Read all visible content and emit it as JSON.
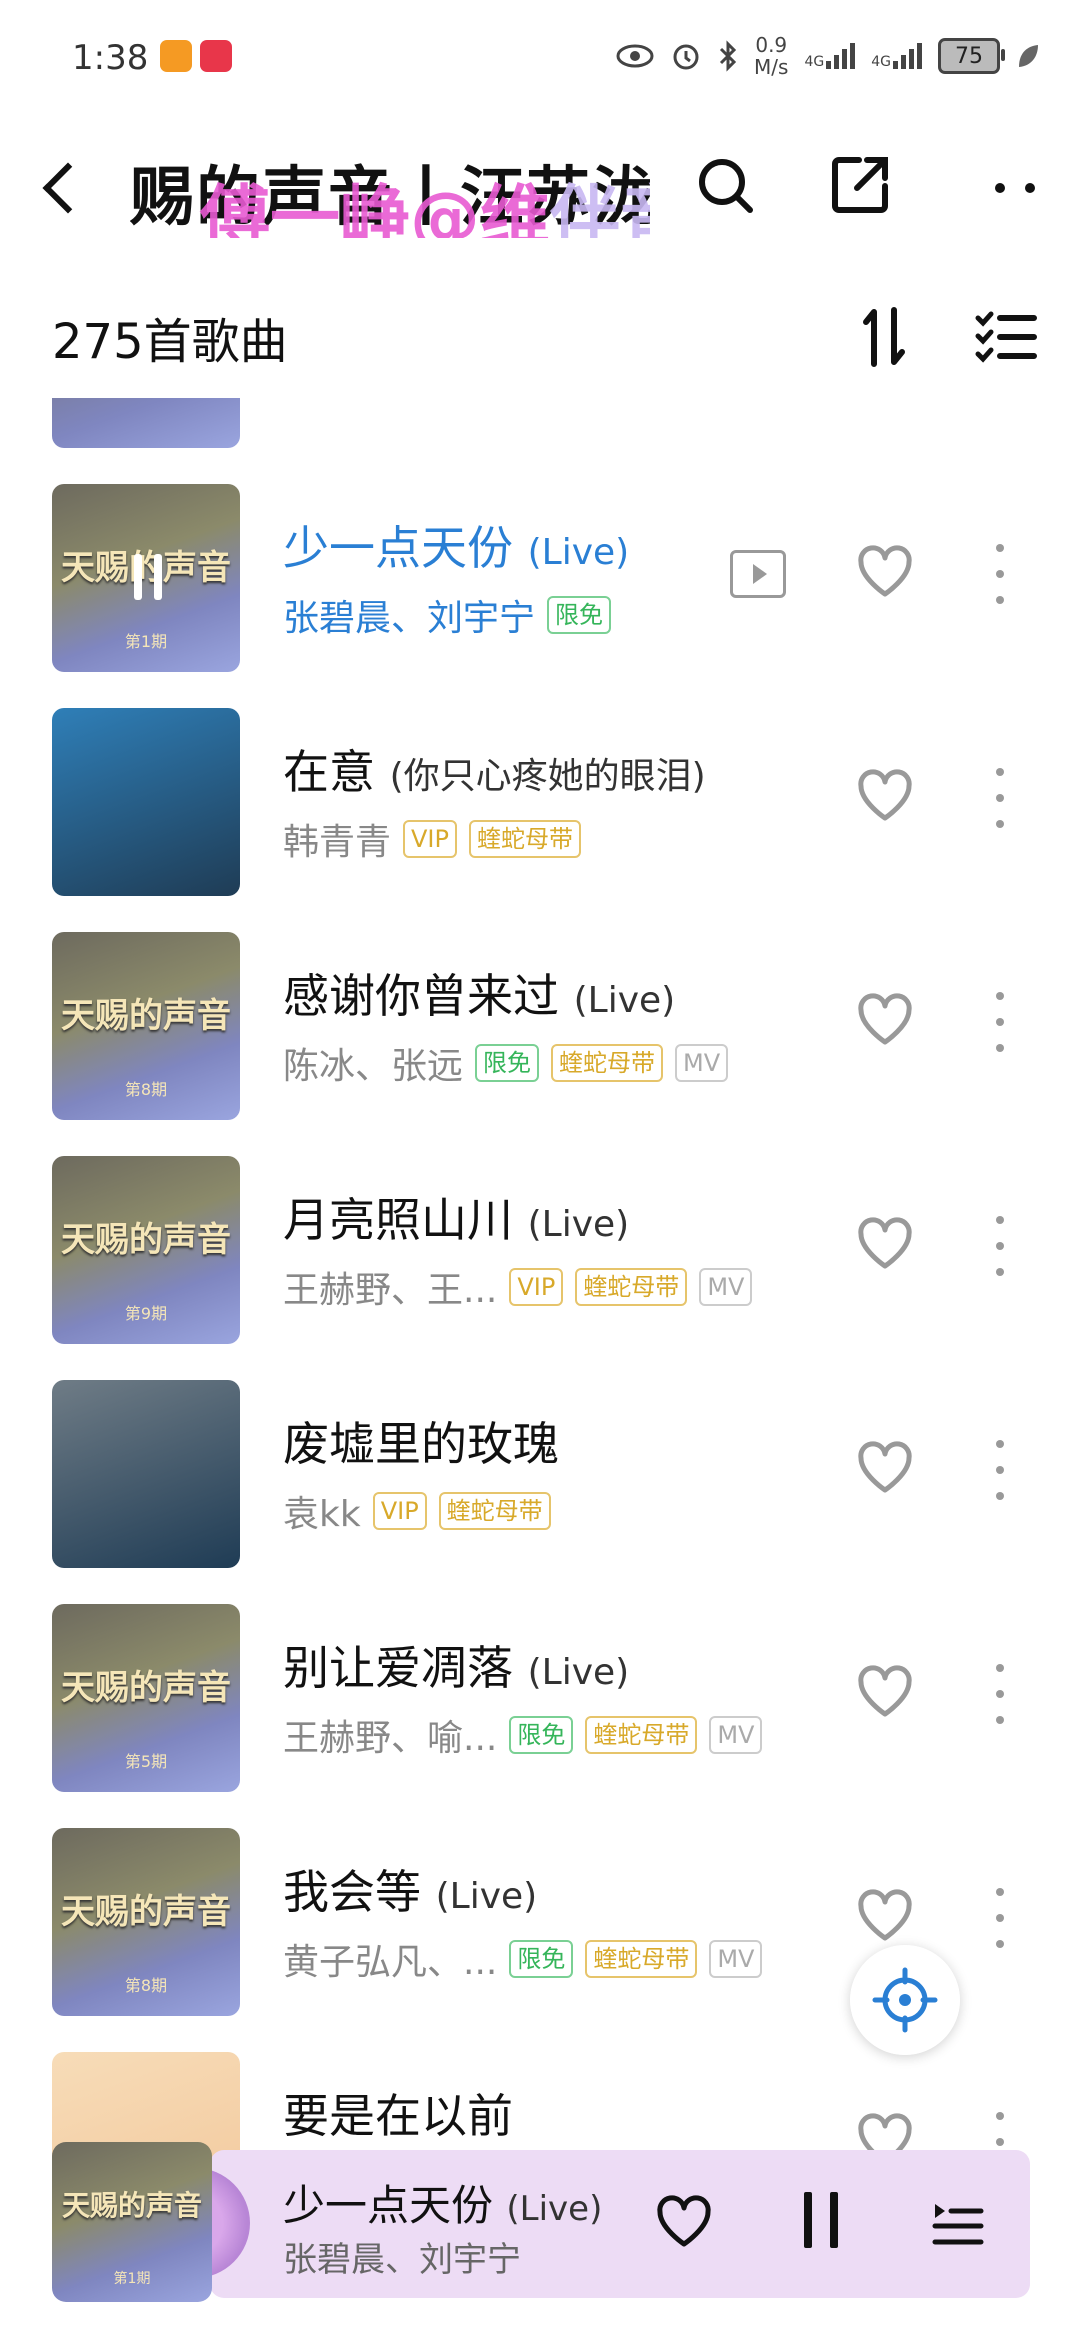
{
  "status_bar": {
    "time": "1:38",
    "net_speed_value": "0.9",
    "net_speed_unit": "M/s",
    "signal_1": "4G",
    "signal_2": "4G",
    "battery": "75"
  },
  "header": {
    "title": "赐的声音丨汪苏泷",
    "marquee_text_bold": "傅一峥@维",
    "marquee_text_faded": "伴音",
    "icons": [
      "back-icon",
      "search-icon",
      "share-icon",
      "more-icon"
    ]
  },
  "list_header": {
    "song_count": "275首歌曲",
    "icons": [
      "sort-icon",
      "batch-manage-icon"
    ]
  },
  "songs": [
    {
      "title": "少一点天份",
      "suffix": "(Live)",
      "artist": "张碧晨、刘宇宁",
      "tags": [
        "限免"
      ],
      "has_mv_button": true,
      "playing": true,
      "cover_text": "天赐的声音",
      "cover_episode": "第1期",
      "cover_color": "#6d6a5e"
    },
    {
      "title": "在意",
      "suffix": "(你只心疼她的眼泪)",
      "artist": "韩青青",
      "tags": [
        "VIP",
        "蝰蛇母带"
      ],
      "has_mv_button": false,
      "playing": false,
      "cover_text": "",
      "cover_episode": "",
      "cover_color": "#2f7fb8"
    },
    {
      "title": "感谢你曾来过",
      "suffix": "(Live)",
      "artist": "陈冰、张远",
      "tags": [
        "限免",
        "蝰蛇母带",
        "MV"
      ],
      "has_mv_button": false,
      "playing": false,
      "cover_text": "天赐的声音",
      "cover_episode": "第8期",
      "cover_color": "#6d6a5e"
    },
    {
      "title": "月亮照山川",
      "suffix": "(Live)",
      "artist": "王赫野、王...",
      "tags": [
        "VIP",
        "蝰蛇母带",
        "MV"
      ],
      "has_mv_button": false,
      "playing": false,
      "cover_text": "天赐的声音",
      "cover_episode": "第9期",
      "cover_color": "#6d6a5e"
    },
    {
      "title": "废墟里的玫瑰",
      "suffix": "",
      "artist": "袁kk",
      "tags": [
        "VIP",
        "蝰蛇母带"
      ],
      "has_mv_button": false,
      "playing": false,
      "cover_text": "",
      "cover_episode": "",
      "cover_color": "#6f7c86"
    },
    {
      "title": "别让爱凋落",
      "suffix": "(Live)",
      "artist": "王赫野、喻...",
      "tags": [
        "限免",
        "蝰蛇母带",
        "MV"
      ],
      "has_mv_button": false,
      "playing": false,
      "cover_text": "天赐的声音",
      "cover_episode": "第5期",
      "cover_color": "#6d6a5e"
    },
    {
      "title": "我会等",
      "suffix": "(Live)",
      "artist": "黄子弘凡、...",
      "tags": [
        "限免",
        "蝰蛇母带",
        "MV"
      ],
      "has_mv_button": false,
      "playing": false,
      "cover_text": "天赐的声音",
      "cover_episode": "第8期",
      "cover_color": "#6d6a5e"
    },
    {
      "title": "要是在以前",
      "suffix": "",
      "artist": "",
      "tags": [],
      "has_mv_button": false,
      "playing": false,
      "cover_text": "",
      "cover_episode": "",
      "cover_color": "#f2c79a"
    }
  ],
  "mini_player": {
    "title": "少一点天份",
    "suffix": "(Live)",
    "artist": "张碧晨、刘宇宁",
    "cover_text": "天赐的声音",
    "cover_episode": "第1期"
  },
  "colors": {
    "accent_blue": "#2a7fd4",
    "free_green": "#35b55a",
    "vip_gold": "#d8a92a",
    "mini_player_bg": "#eddcf5"
  }
}
